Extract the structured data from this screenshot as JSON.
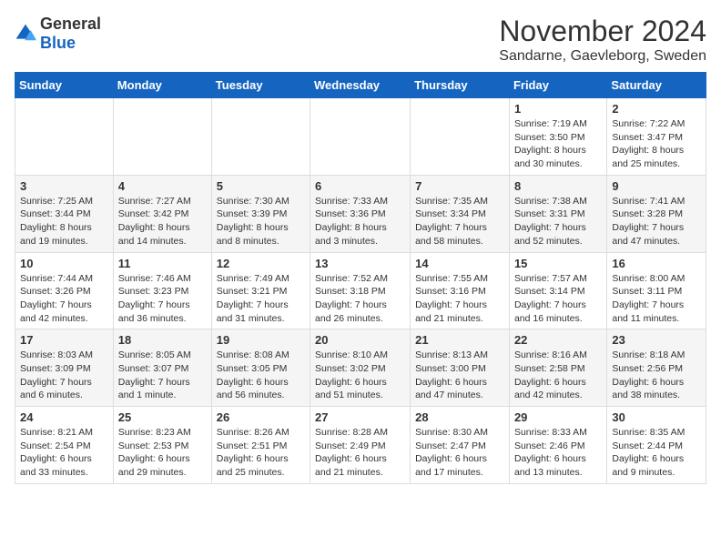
{
  "logo": {
    "text_general": "General",
    "text_blue": "Blue"
  },
  "title": "November 2024",
  "location": "Sandarne, Gaevleborg, Sweden",
  "days_of_week": [
    "Sunday",
    "Monday",
    "Tuesday",
    "Wednesday",
    "Thursday",
    "Friday",
    "Saturday"
  ],
  "weeks": [
    [
      {
        "day": "",
        "info": ""
      },
      {
        "day": "",
        "info": ""
      },
      {
        "day": "",
        "info": ""
      },
      {
        "day": "",
        "info": ""
      },
      {
        "day": "",
        "info": ""
      },
      {
        "day": "1",
        "info": "Sunrise: 7:19 AM\nSunset: 3:50 PM\nDaylight: 8 hours and 30 minutes."
      },
      {
        "day": "2",
        "info": "Sunrise: 7:22 AM\nSunset: 3:47 PM\nDaylight: 8 hours and 25 minutes."
      }
    ],
    [
      {
        "day": "3",
        "info": "Sunrise: 7:25 AM\nSunset: 3:44 PM\nDaylight: 8 hours and 19 minutes."
      },
      {
        "day": "4",
        "info": "Sunrise: 7:27 AM\nSunset: 3:42 PM\nDaylight: 8 hours and 14 minutes."
      },
      {
        "day": "5",
        "info": "Sunrise: 7:30 AM\nSunset: 3:39 PM\nDaylight: 8 hours and 8 minutes."
      },
      {
        "day": "6",
        "info": "Sunrise: 7:33 AM\nSunset: 3:36 PM\nDaylight: 8 hours and 3 minutes."
      },
      {
        "day": "7",
        "info": "Sunrise: 7:35 AM\nSunset: 3:34 PM\nDaylight: 7 hours and 58 minutes."
      },
      {
        "day": "8",
        "info": "Sunrise: 7:38 AM\nSunset: 3:31 PM\nDaylight: 7 hours and 52 minutes."
      },
      {
        "day": "9",
        "info": "Sunrise: 7:41 AM\nSunset: 3:28 PM\nDaylight: 7 hours and 47 minutes."
      }
    ],
    [
      {
        "day": "10",
        "info": "Sunrise: 7:44 AM\nSunset: 3:26 PM\nDaylight: 7 hours and 42 minutes."
      },
      {
        "day": "11",
        "info": "Sunrise: 7:46 AM\nSunset: 3:23 PM\nDaylight: 7 hours and 36 minutes."
      },
      {
        "day": "12",
        "info": "Sunrise: 7:49 AM\nSunset: 3:21 PM\nDaylight: 7 hours and 31 minutes."
      },
      {
        "day": "13",
        "info": "Sunrise: 7:52 AM\nSunset: 3:18 PM\nDaylight: 7 hours and 26 minutes."
      },
      {
        "day": "14",
        "info": "Sunrise: 7:55 AM\nSunset: 3:16 PM\nDaylight: 7 hours and 21 minutes."
      },
      {
        "day": "15",
        "info": "Sunrise: 7:57 AM\nSunset: 3:14 PM\nDaylight: 7 hours and 16 minutes."
      },
      {
        "day": "16",
        "info": "Sunrise: 8:00 AM\nSunset: 3:11 PM\nDaylight: 7 hours and 11 minutes."
      }
    ],
    [
      {
        "day": "17",
        "info": "Sunrise: 8:03 AM\nSunset: 3:09 PM\nDaylight: 7 hours and 6 minutes."
      },
      {
        "day": "18",
        "info": "Sunrise: 8:05 AM\nSunset: 3:07 PM\nDaylight: 7 hours and 1 minute."
      },
      {
        "day": "19",
        "info": "Sunrise: 8:08 AM\nSunset: 3:05 PM\nDaylight: 6 hours and 56 minutes."
      },
      {
        "day": "20",
        "info": "Sunrise: 8:10 AM\nSunset: 3:02 PM\nDaylight: 6 hours and 51 minutes."
      },
      {
        "day": "21",
        "info": "Sunrise: 8:13 AM\nSunset: 3:00 PM\nDaylight: 6 hours and 47 minutes."
      },
      {
        "day": "22",
        "info": "Sunrise: 8:16 AM\nSunset: 2:58 PM\nDaylight: 6 hours and 42 minutes."
      },
      {
        "day": "23",
        "info": "Sunrise: 8:18 AM\nSunset: 2:56 PM\nDaylight: 6 hours and 38 minutes."
      }
    ],
    [
      {
        "day": "24",
        "info": "Sunrise: 8:21 AM\nSunset: 2:54 PM\nDaylight: 6 hours and 33 minutes."
      },
      {
        "day": "25",
        "info": "Sunrise: 8:23 AM\nSunset: 2:53 PM\nDaylight: 6 hours and 29 minutes."
      },
      {
        "day": "26",
        "info": "Sunrise: 8:26 AM\nSunset: 2:51 PM\nDaylight: 6 hours and 25 minutes."
      },
      {
        "day": "27",
        "info": "Sunrise: 8:28 AM\nSunset: 2:49 PM\nDaylight: 6 hours and 21 minutes."
      },
      {
        "day": "28",
        "info": "Sunrise: 8:30 AM\nSunset: 2:47 PM\nDaylight: 6 hours and 17 minutes."
      },
      {
        "day": "29",
        "info": "Sunrise: 8:33 AM\nSunset: 2:46 PM\nDaylight: 6 hours and 13 minutes."
      },
      {
        "day": "30",
        "info": "Sunrise: 8:35 AM\nSunset: 2:44 PM\nDaylight: 6 hours and 9 minutes."
      }
    ]
  ]
}
